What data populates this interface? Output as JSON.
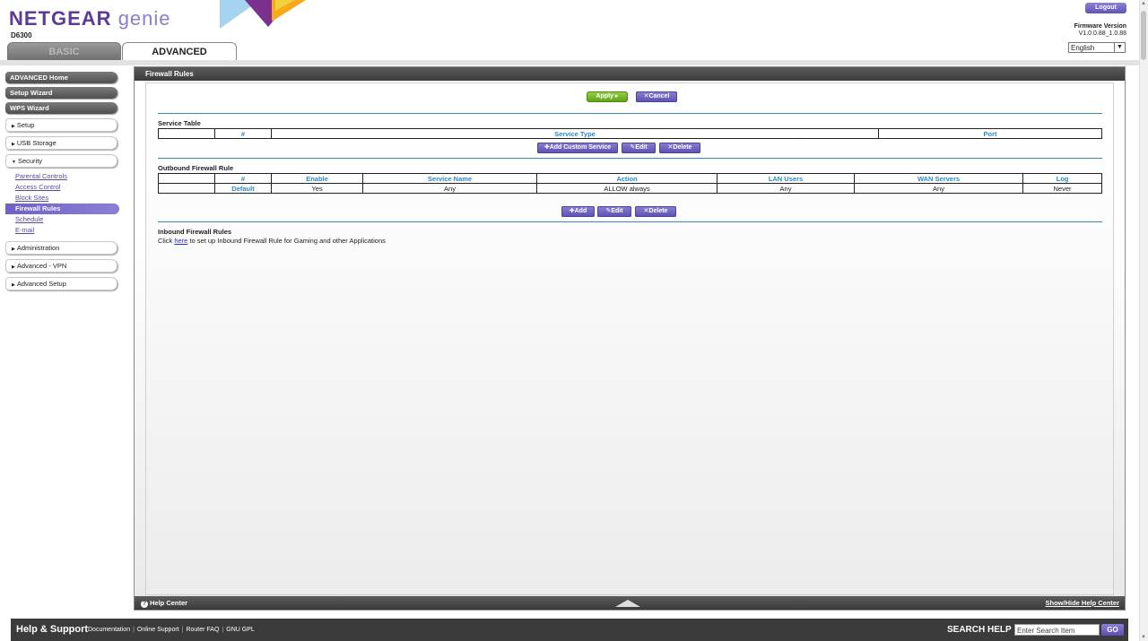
{
  "header": {
    "logo_main": "NETGEAR",
    "logo_genie": "genie",
    "model": "D6300",
    "logout_label": "Logout",
    "firmware_label": "Firmware Version",
    "firmware_value": "V1.0.0.88_1.0.88",
    "language": "English"
  },
  "tabs": {
    "basic": "BASIC",
    "advanced": "ADVANCED"
  },
  "sidebar": {
    "advanced_home": "ADVANCED Home",
    "setup_wizard": "Setup Wizard",
    "wps_wizard": "WPS Wizard",
    "setup": "Setup",
    "usb_storage": "USB Storage",
    "security": "Security",
    "security_items": [
      "Parental Controls",
      "Access Control",
      "Block Sites",
      "Firewall Rules",
      "Schedule",
      "E-mail"
    ],
    "administration": "Administration",
    "advanced_vpn": "Advanced - VPN",
    "advanced_setup": "Advanced Setup"
  },
  "panel": {
    "title": "Firewall Rules",
    "apply_label": "Apply ▸",
    "cancel_label": "Cancel",
    "service_table": {
      "title": "Service Table",
      "headers": [
        "#",
        "Service Type",
        "Port"
      ],
      "add_custom_label": "Add Custom Service",
      "edit_label": "Edit",
      "delete_label": "Delete"
    },
    "outbound": {
      "title": "Outbound Firewall Rule",
      "headers": [
        "#",
        "Enable",
        "Service Name",
        "Action",
        "LAN Users",
        "WAN Servers",
        "Log"
      ],
      "rows": [
        [
          "Default",
          "Yes",
          "Any",
          "ALLOW always",
          "Any",
          "Any",
          "Never"
        ]
      ],
      "add_label": "Add",
      "edit_label": "Edit",
      "delete_label": "Delete"
    },
    "inbound": {
      "title": "Inbound Firewall Rules",
      "text_before": "Click ",
      "link": "here",
      "text_after": " to set up Inbound Firewall Rule for Gaming and other Applications"
    },
    "footer": {
      "help_center": "Help Center",
      "show_hide": "Show/Hide Help Center"
    }
  },
  "bottom": {
    "help_support": "Help & Support",
    "links": [
      "Documentation",
      "Online Support",
      "Router FAQ",
      "GNU GPL"
    ],
    "search_label": "SEARCH HELP",
    "search_placeholder": "Enter Search Item",
    "go_label": "GO"
  }
}
